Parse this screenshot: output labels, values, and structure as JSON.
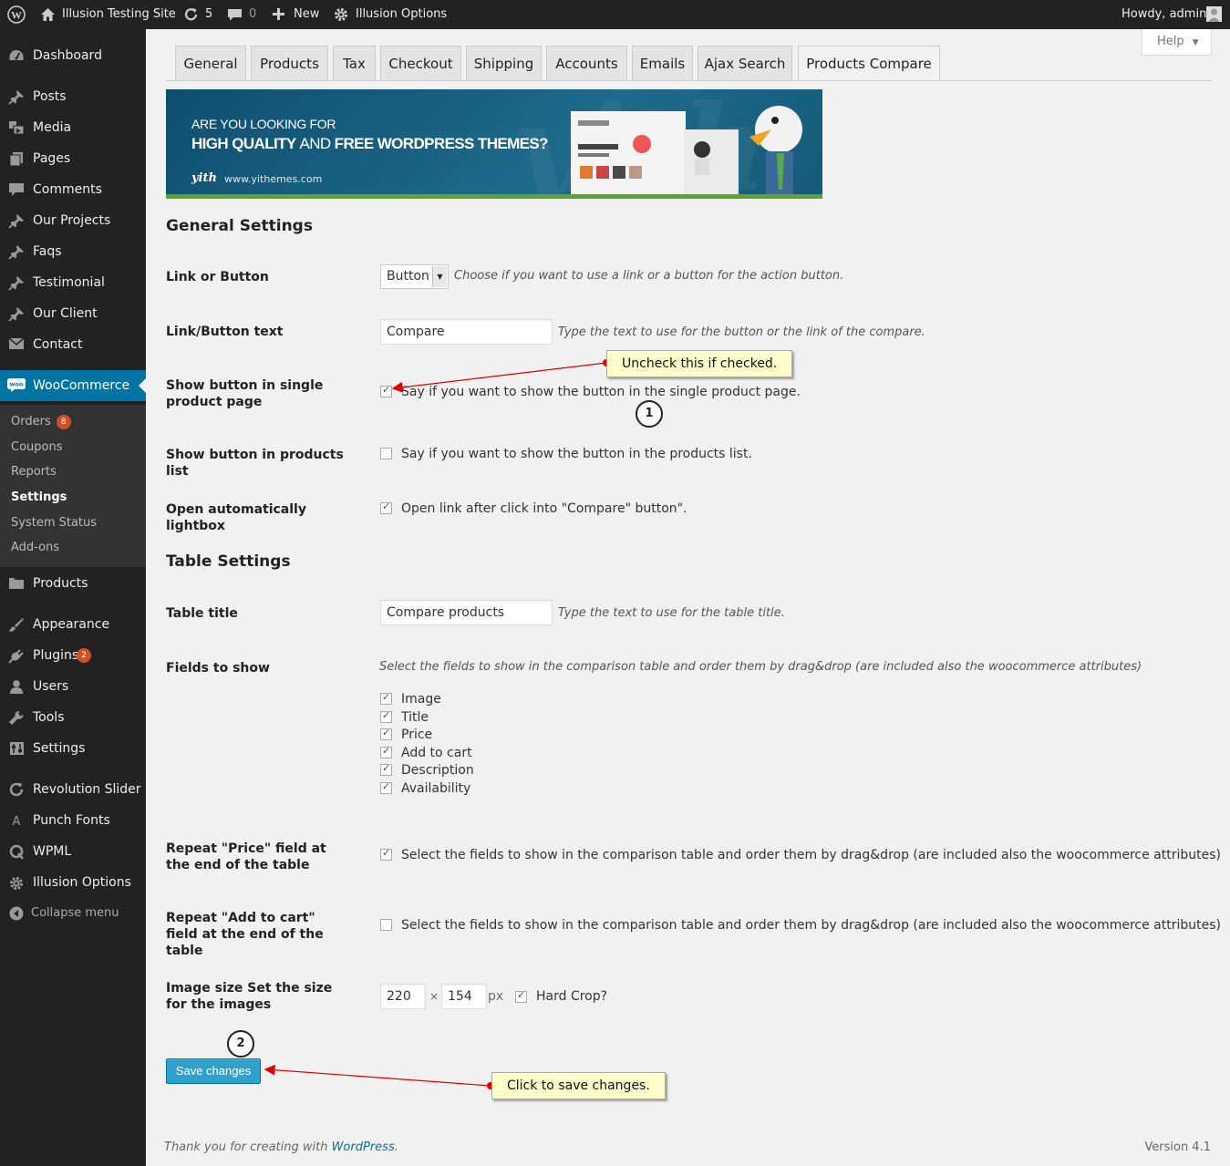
{
  "adminbar": {
    "site_name": "Illusion Testing Site",
    "updates_count": "5",
    "comments_count": "0",
    "new_label": "New",
    "options_label": "Illusion Options",
    "howdy": "Howdy, admin"
  },
  "sidebar": {
    "items": [
      {
        "label": "Dashboard",
        "icon": "dashboard-icon"
      },
      {
        "label": "Posts",
        "icon": "pin-icon"
      },
      {
        "label": "Media",
        "icon": "media-icon"
      },
      {
        "label": "Pages",
        "icon": "pages-icon"
      },
      {
        "label": "Comments",
        "icon": "comment-icon"
      },
      {
        "label": "Our Projects",
        "icon": "pin-icon"
      },
      {
        "label": "Faqs",
        "icon": "pin-icon"
      },
      {
        "label": "Testimonial",
        "icon": "pin-icon"
      },
      {
        "label": "Our Client",
        "icon": "pin-icon"
      },
      {
        "label": "Contact",
        "icon": "mail-icon"
      },
      {
        "label": "WooCommerce",
        "icon": "woocommerce-icon"
      },
      {
        "label": "Products",
        "icon": "products-icon"
      },
      {
        "label": "Appearance",
        "icon": "brush-icon"
      },
      {
        "label": "Plugins",
        "icon": "plugin-icon",
        "badge": "2"
      },
      {
        "label": "Users",
        "icon": "user-icon"
      },
      {
        "label": "Tools",
        "icon": "wrench-icon"
      },
      {
        "label": "Settings",
        "icon": "settings-icon"
      },
      {
        "label": "Revolution Slider",
        "icon": "refresh-icon"
      },
      {
        "label": "Punch Fonts",
        "icon": "font-icon"
      },
      {
        "label": "WPML",
        "icon": "wpml-icon"
      },
      {
        "label": "Illusion Options",
        "icon": "gear-icon"
      },
      {
        "label": "Collapse menu",
        "icon": "collapse-icon"
      }
    ],
    "woocommerce_sub": [
      {
        "label": "Orders",
        "badge": "8"
      },
      {
        "label": "Coupons"
      },
      {
        "label": "Reports"
      },
      {
        "label": "Settings"
      },
      {
        "label": "System Status"
      },
      {
        "label": "Add-ons"
      }
    ]
  },
  "help_label": "Help",
  "tabs": [
    "General",
    "Products",
    "Tax",
    "Checkout",
    "Shipping",
    "Accounts",
    "Emails",
    "Ajax Search",
    "Products Compare"
  ],
  "banner": {
    "line1": "ARE YOU LOOKING FOR",
    "line2a": "HIGH QUALITY",
    "line2b": "AND",
    "line2c": "FREE WORDPRESS THEMES?",
    "logo": "yith",
    "url": "www.yithemes.com"
  },
  "general": {
    "heading": "General Settings",
    "link_or_button": {
      "label": "Link or Button",
      "value": "Button",
      "desc": "Choose if you want to use a link or a button for the action button."
    },
    "button_text": {
      "label": "Link/Button text",
      "value": "Compare",
      "desc": "Type the text to use for the button or the link of the compare."
    },
    "show_single": {
      "label": "Show button in single product page",
      "desc": "Say if you want to show the button in the single product page.",
      "checked": true
    },
    "show_list": {
      "label": "Show button in products list",
      "desc": "Say if you want to show the button in the products list.",
      "checked": false
    },
    "lightbox": {
      "label": "Open automatically lightbox",
      "desc": "Open link after click into \"Compare\" button\".",
      "checked": true
    }
  },
  "table": {
    "heading": "Table Settings",
    "title": {
      "label": "Table title",
      "value": "Compare products",
      "desc": "Type the text to use for the table title."
    },
    "fields": {
      "label": "Fields to show",
      "desc": "Select the fields to show in the comparison table and order them by drag&drop (are included also the woocommerce attributes)",
      "items": [
        "Image",
        "Title",
        "Price",
        "Add to cart",
        "Description",
        "Availability"
      ]
    },
    "repeat_price": {
      "label": "Repeat \"Price\" field at the end of the table",
      "desc": "Select the fields to show in the comparison table and order them by drag&drop (are included also the woocommerce attributes)",
      "checked": true
    },
    "repeat_cart": {
      "label": "Repeat \"Add to cart\" field at the end of the table",
      "desc": "Select the fields to show in the comparison table and order them by drag&drop (are included also the woocommerce attributes)",
      "checked": false
    },
    "image_size": {
      "label": "Image size Set the size for the images",
      "width": "220",
      "times": "×",
      "height": "154",
      "unit": "px",
      "crop_label": "Hard Crop?",
      "crop": true
    }
  },
  "callouts": {
    "uncheck": "Uncheck this if checked.",
    "save": "Click to save changes.",
    "step1": "1",
    "step2": "2"
  },
  "save_label": "Save changes",
  "footer": {
    "thanks": "Thank you for creating with ",
    "wp": "WordPress",
    "dot": ".",
    "version": "Version 4.1"
  },
  "colors": {
    "accent": "#0074a2",
    "button": "#2ea2cc",
    "badge": "#d54e21",
    "callout": "#ffffcc",
    "arrow": "#e00000"
  }
}
